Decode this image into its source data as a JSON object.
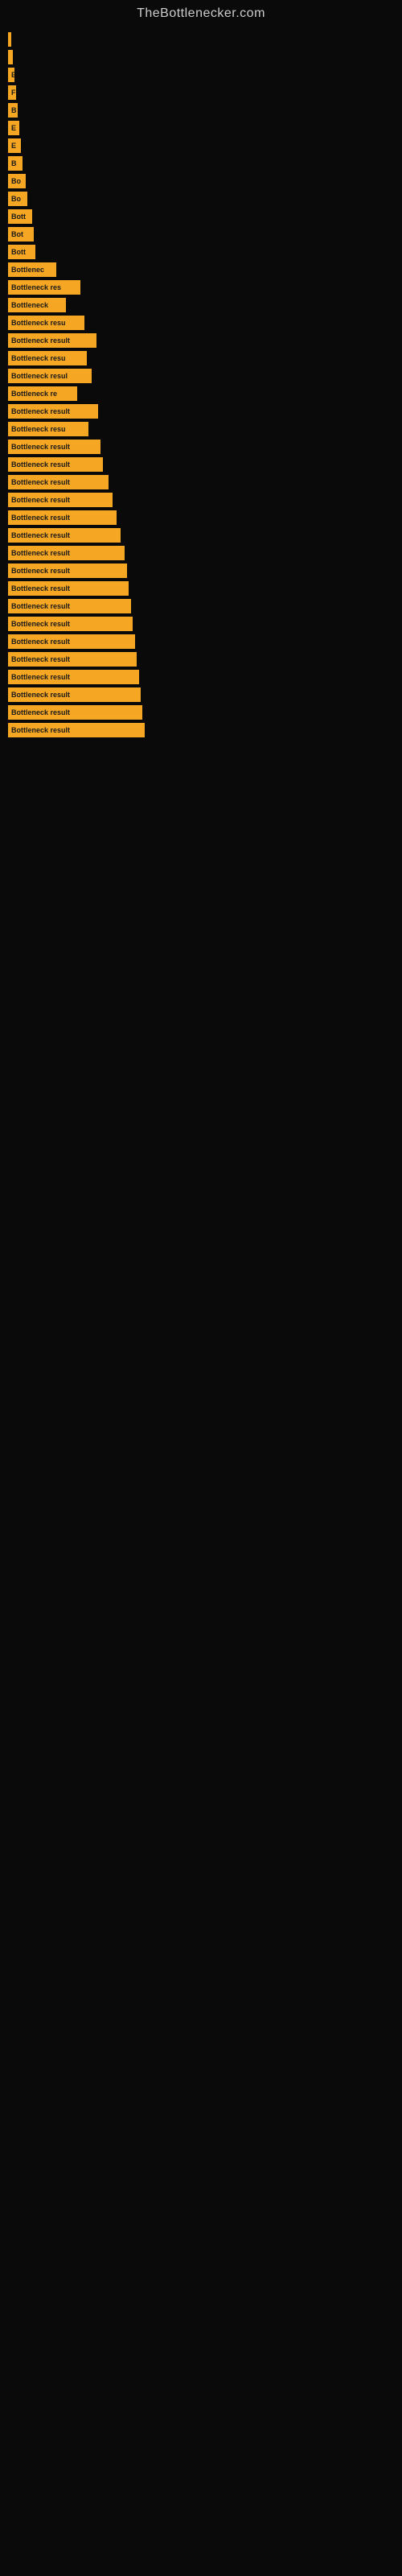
{
  "site": {
    "title": "TheBottlenecker.com"
  },
  "bars": [
    {
      "label": "",
      "width": 4
    },
    {
      "label": "",
      "width": 6
    },
    {
      "label": "E",
      "width": 8
    },
    {
      "label": "F",
      "width": 10
    },
    {
      "label": "B",
      "width": 12
    },
    {
      "label": "E",
      "width": 14
    },
    {
      "label": "E",
      "width": 16
    },
    {
      "label": "B",
      "width": 18
    },
    {
      "label": "Bo",
      "width": 22
    },
    {
      "label": "Bo",
      "width": 24
    },
    {
      "label": "Bott",
      "width": 30
    },
    {
      "label": "Bot",
      "width": 32
    },
    {
      "label": "Bott",
      "width": 34
    },
    {
      "label": "Bottlenec",
      "width": 60
    },
    {
      "label": "Bottleneck res",
      "width": 90
    },
    {
      "label": "Bottleneck",
      "width": 72
    },
    {
      "label": "Bottleneck resu",
      "width": 95
    },
    {
      "label": "Bottleneck result",
      "width": 110
    },
    {
      "label": "Bottleneck resu",
      "width": 98
    },
    {
      "label": "Bottleneck resul",
      "width": 104
    },
    {
      "label": "Bottleneck re",
      "width": 86
    },
    {
      "label": "Bottleneck result",
      "width": 112
    },
    {
      "label": "Bottleneck resu",
      "width": 100
    },
    {
      "label": "Bottleneck result",
      "width": 115
    },
    {
      "label": "Bottleneck result",
      "width": 118
    },
    {
      "label": "Bottleneck result",
      "width": 125
    },
    {
      "label": "Bottleneck result",
      "width": 130
    },
    {
      "label": "Bottleneck result",
      "width": 135
    },
    {
      "label": "Bottleneck result",
      "width": 140
    },
    {
      "label": "Bottleneck result",
      "width": 145
    },
    {
      "label": "Bottleneck result",
      "width": 148
    },
    {
      "label": "Bottleneck result",
      "width": 150
    },
    {
      "label": "Bottleneck result",
      "width": 153
    },
    {
      "label": "Bottleneck result",
      "width": 155
    },
    {
      "label": "Bottleneck result",
      "width": 158
    },
    {
      "label": "Bottleneck result",
      "width": 160
    },
    {
      "label": "Bottleneck result",
      "width": 163
    },
    {
      "label": "Bottleneck result",
      "width": 165
    },
    {
      "label": "Bottleneck result",
      "width": 167
    },
    {
      "label": "Bottleneck result",
      "width": 170
    }
  ]
}
